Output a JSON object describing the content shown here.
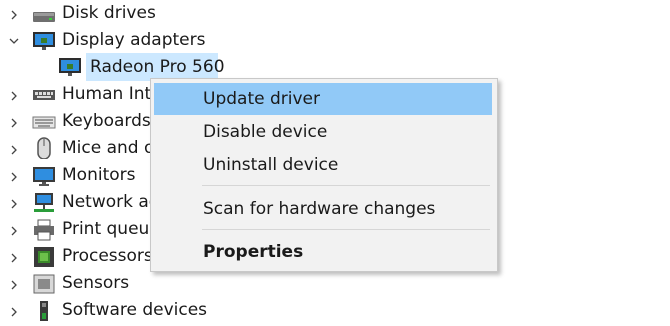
{
  "tree": {
    "items": [
      {
        "label": "Disk drives",
        "expanded": false,
        "icon": "disk-drive-icon"
      },
      {
        "label": "Display adapters",
        "expanded": true,
        "icon": "display-adapter-icon"
      },
      {
        "label": "Radeon Pro 560",
        "child": true,
        "selected": true,
        "icon": "display-adapter-icon"
      },
      {
        "label": "Human Inte",
        "expanded": false,
        "icon": "human-interface-icon"
      },
      {
        "label": "Keyboards",
        "expanded": false,
        "icon": "keyboard-icon"
      },
      {
        "label": "Mice and o",
        "expanded": false,
        "icon": "mouse-icon"
      },
      {
        "label": "Monitors",
        "expanded": false,
        "icon": "monitor-icon"
      },
      {
        "label": "Network ad",
        "expanded": false,
        "icon": "network-adapter-icon"
      },
      {
        "label": "Print queue",
        "expanded": false,
        "icon": "printer-icon"
      },
      {
        "label": "Processors",
        "expanded": false,
        "icon": "processor-icon"
      },
      {
        "label": "Sensors",
        "expanded": false,
        "icon": "sensor-icon"
      },
      {
        "label": "Software devices",
        "expanded": false,
        "icon": "software-device-icon"
      }
    ]
  },
  "context_menu": {
    "items": [
      {
        "label": "Update driver",
        "highlighted": true
      },
      {
        "label": "Disable device"
      },
      {
        "label": "Uninstall device"
      },
      {
        "label": "Scan for hardware changes"
      },
      {
        "label": "Properties",
        "bold": true
      }
    ]
  },
  "colors": {
    "selection": "#cce8ff",
    "menu_highlight": "#91c9f7",
    "menu_background": "#f2f2f2"
  }
}
